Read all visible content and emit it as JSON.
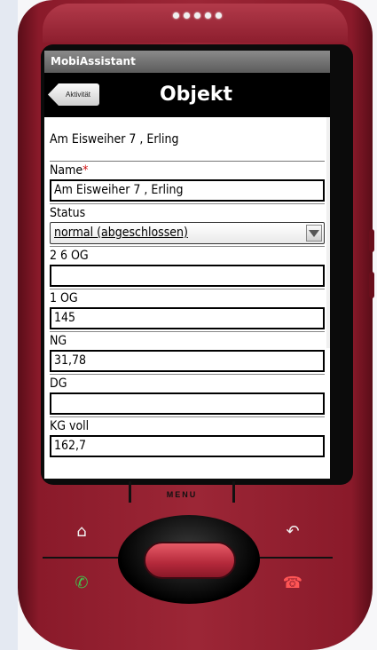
{
  "app": {
    "name": "MobiAssistant"
  },
  "titlebar": {
    "back_label": "Aktivität",
    "title": "Objekt"
  },
  "header": {
    "text": "Am Eisweiher 7 , Erling"
  },
  "form": {
    "name": {
      "label": "Name",
      "required_marker": "*",
      "value": "Am Eisweiher  7 , Erling"
    },
    "status": {
      "label": "Status",
      "value": "normal (abgeschlossen)"
    },
    "og26": {
      "label": "2 6 OG",
      "value": ""
    },
    "og1": {
      "label": "1 OG",
      "value": "145"
    },
    "ng": {
      "label": "NG",
      "value": "31,78"
    },
    "dg": {
      "label": "DG",
      "value": ""
    },
    "kg": {
      "label": "KG voll",
      "value": "162,7"
    }
  },
  "hardware": {
    "menu_label": "MENU",
    "icons": [
      "home-icon",
      "back-icon",
      "call-icon",
      "end-call-icon"
    ],
    "colors": {
      "body": "#9c2636",
      "call": "#43c24c",
      "end_call": "#ff5555"
    }
  }
}
